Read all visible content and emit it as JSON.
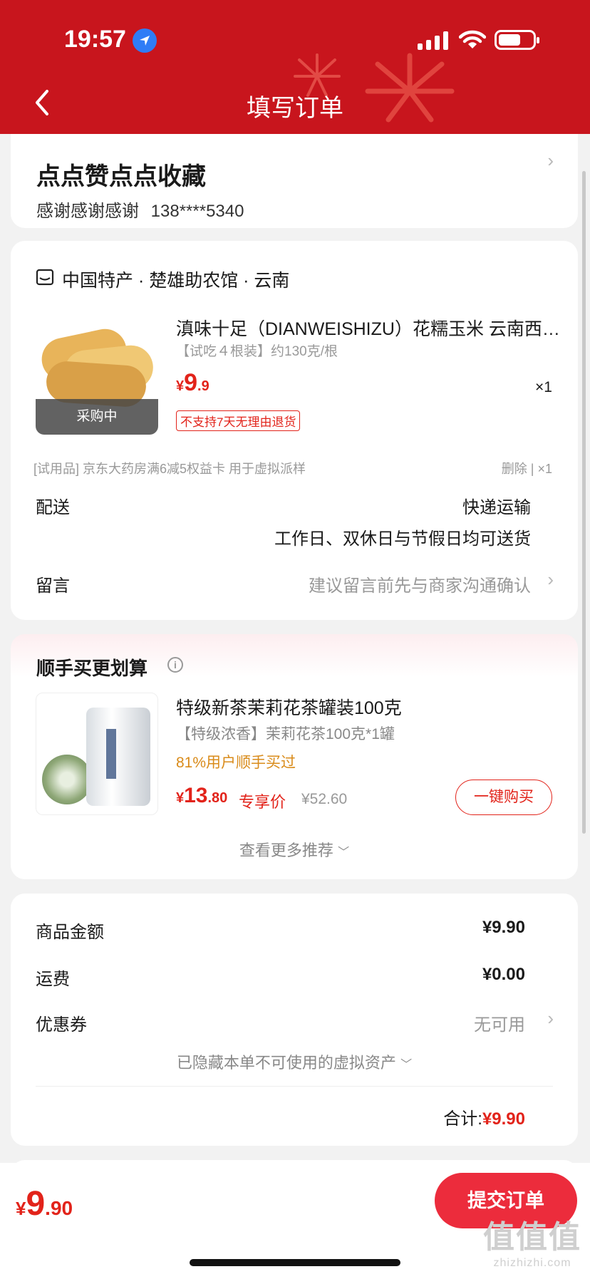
{
  "status_bar": {
    "time": "19:57"
  },
  "header": {
    "title": "填写订单"
  },
  "address": {
    "name": "点点赞点点收藏",
    "contact_name": "感谢感谢感谢",
    "phone": "138****5340"
  },
  "order": {
    "store": "中国特产 · 楚雄助农馆 · 云南",
    "product": {
      "title": "滇味十足（DIANWEISHIZU）花糯玉米 云南西双版纳",
      "spec": "【试吃４根装】约130克/根",
      "price_currency": "¥",
      "price_int": "9",
      "price_dec": ".9",
      "quantity": "×1",
      "no_return_tag": "不支持7天无理由退货",
      "image_tag": "采购中"
    },
    "gift": {
      "text": "[试用品] 京东大药房满6减5权益卡 用于虚拟派样",
      "action": "删除 | ×1"
    },
    "delivery": {
      "label": "配送",
      "method": "快递运输",
      "schedule": "工作日、双休日与节假日均可送货"
    },
    "message": {
      "label": "留言",
      "placeholder": "建议留言前先与商家沟通确认"
    }
  },
  "recommend": {
    "title": "顺手买更划算",
    "item": {
      "name": "特级新茶茉莉花茶罐装100克",
      "spec": "【特级浓香】茉莉花茶100克*1罐",
      "users": "81%用户顺手买过",
      "price_currency": "¥",
      "price_int": "13",
      "price_dec": ".80",
      "exclusive_label": "专享价",
      "original_price": "¥52.60",
      "buy_label": "一键购买"
    },
    "more_label": "查看更多推荐"
  },
  "summary": {
    "goods_label": "商品金额",
    "goods_value": "¥9.90",
    "shipping_label": "运费",
    "shipping_value": "¥0.00",
    "coupon_label": "优惠券",
    "coupon_value": "无可用",
    "hidden_assets": "已隐藏本单不可使用的虚拟资产",
    "total_label": "合计:",
    "total_value": "¥9.90"
  },
  "bottom": {
    "price_currency": "¥",
    "price_int": "9",
    "price_dec": ".90",
    "submit_label": "提交订单"
  },
  "watermark": {
    "big": "值值值",
    "small": "zhizhizhi.com"
  },
  "colors": {
    "brand_red": "#c8151d",
    "price_red": "#e2231a",
    "button_red": "#ec2c3c"
  }
}
